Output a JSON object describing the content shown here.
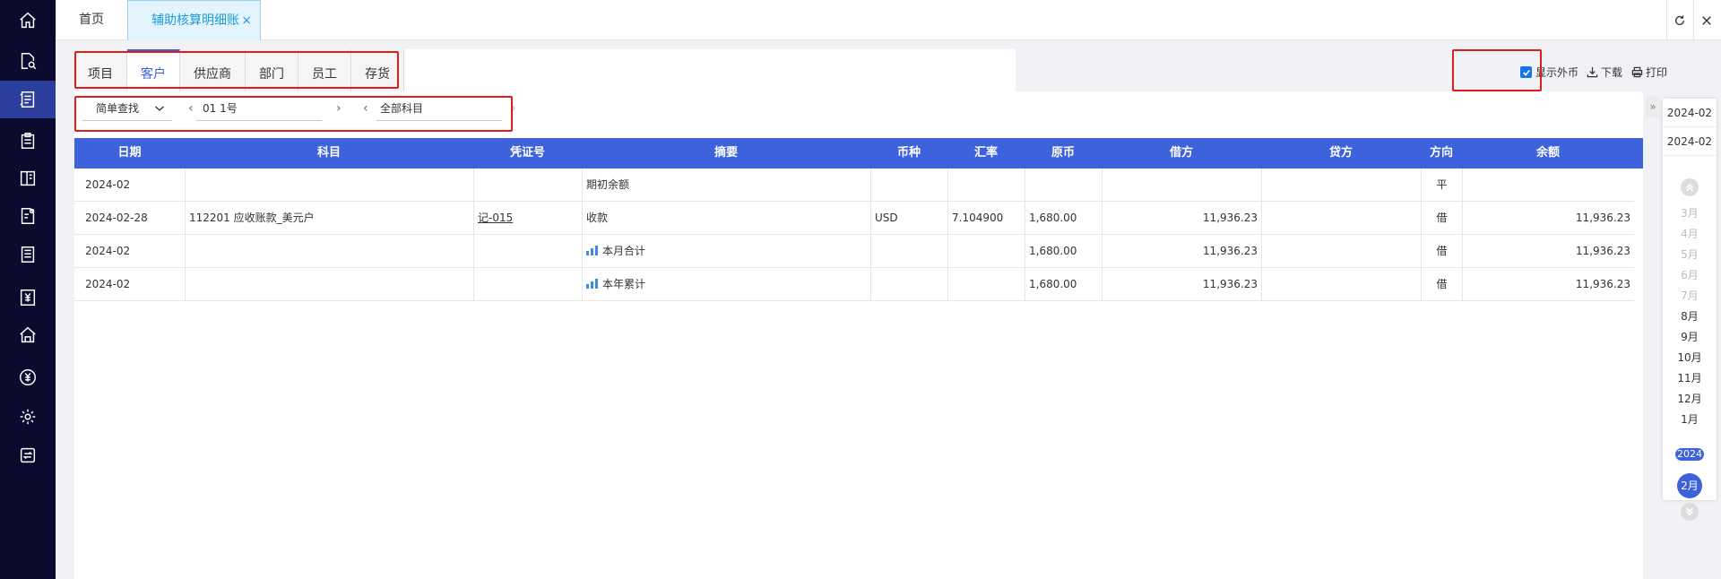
{
  "nav": {
    "items": [
      {
        "icon": "home-icon"
      },
      {
        "icon": "document-search-icon"
      },
      {
        "icon": "ledger-icon"
      },
      {
        "icon": "clipboard-icon"
      },
      {
        "icon": "book-icon"
      },
      {
        "icon": "document-settings-icon"
      },
      {
        "icon": "list-document-icon"
      },
      {
        "icon": "yen-document-icon"
      },
      {
        "icon": "building-icon"
      },
      {
        "icon": "yen-circle-icon"
      },
      {
        "icon": "gear-icon"
      },
      {
        "icon": "transfer-icon"
      }
    ]
  },
  "tabs": {
    "home": "首页",
    "active": "辅助核算明细账",
    "close": "×"
  },
  "aux_tabs": [
    "项目",
    "客户",
    "供应商",
    "部门",
    "员工",
    "存货"
  ],
  "tools": {
    "show_foreign_currency": "显示外币",
    "download": "下载",
    "print": "打印"
  },
  "filter": {
    "search_mode": "简单查找",
    "entity": "01 1号",
    "subject": "全部科目"
  },
  "table": {
    "headers": [
      "日期",
      "科目",
      "凭证号",
      "摘要",
      "币种",
      "汇率",
      "原币",
      "借方",
      "贷方",
      "方向",
      "余额"
    ],
    "rows": [
      {
        "date": "2024-02",
        "subject": "",
        "voucher": "",
        "summary": "期初余额",
        "summary_icon": false,
        "currency": "",
        "rate": "",
        "original": "",
        "debit": "",
        "credit": "",
        "direction": "平",
        "balance": ""
      },
      {
        "date": "2024-02-28",
        "subject": "112201 应收账款_美元户",
        "voucher": "记-015",
        "summary": "收款",
        "summary_icon": false,
        "currency": "USD",
        "rate": "7.104900",
        "original": "1,680.00",
        "debit": "11,936.23",
        "credit": "",
        "direction": "借",
        "balance": "11,936.23"
      },
      {
        "date": "2024-02",
        "subject": "",
        "voucher": "",
        "summary": "本月合计",
        "summary_icon": true,
        "currency": "",
        "rate": "",
        "original": "1,680.00",
        "debit": "11,936.23",
        "credit": "",
        "direction": "借",
        "balance": "11,936.23"
      },
      {
        "date": "2024-02",
        "subject": "",
        "voucher": "",
        "summary": "本年累计",
        "summary_icon": true,
        "currency": "",
        "rate": "",
        "original": "1,680.00",
        "debit": "11,936.23",
        "credit": "",
        "direction": "借",
        "balance": "11,936.23"
      }
    ]
  },
  "period": {
    "from": "2024-02",
    "to": "2024-02",
    "collapse": "»",
    "months": [
      {
        "label": "3月",
        "enabled": false
      },
      {
        "label": "4月",
        "enabled": false
      },
      {
        "label": "5月",
        "enabled": false
      },
      {
        "label": "6月",
        "enabled": false
      },
      {
        "label": "7月",
        "enabled": false
      },
      {
        "label": "8月",
        "enabled": true
      },
      {
        "label": "9月",
        "enabled": true
      },
      {
        "label": "10月",
        "enabled": true
      },
      {
        "label": "11月",
        "enabled": true
      },
      {
        "label": "12月",
        "enabled": true
      },
      {
        "label": "1月",
        "enabled": true
      }
    ],
    "year_badge": "2024",
    "selected_month": "2月"
  },
  "colors": {
    "nav_bg": "#0a0b2e",
    "nav_active": "#2c3e9b",
    "header_bg": "#3d62db",
    "accent": "#3b5fd6",
    "highlight_border": "#e01c1c"
  }
}
